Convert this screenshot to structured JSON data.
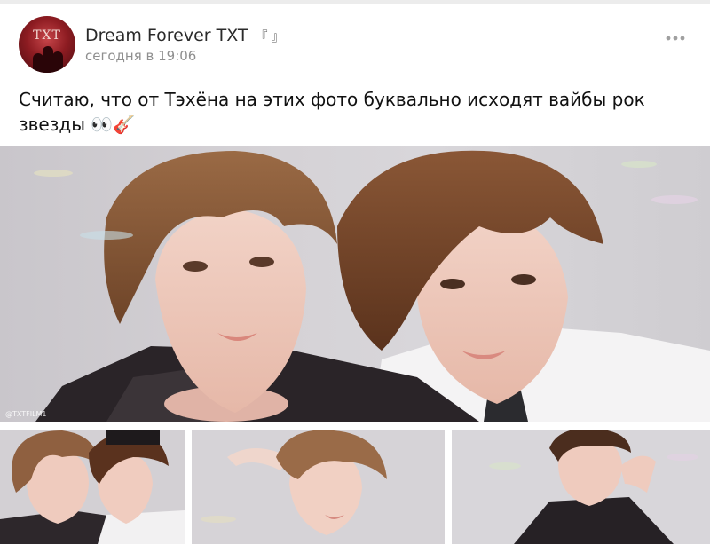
{
  "post": {
    "author": "Dream Forever TXT",
    "author_decoration": "『 』",
    "time": "сегодня в 19:06",
    "menu_icon": "more-icon",
    "text": "Считаю, что от Тэхёна на этих фото буквально исходят вайбы рок звезды 👀🎸"
  },
  "avatar": {
    "glyph": "TXT"
  },
  "photos": {
    "main_watermark": "@TXTFILM1"
  },
  "colors": {
    "author": "#2a2a2a",
    "time": "#8f8f8f",
    "menu": "#9a9a9a"
  }
}
